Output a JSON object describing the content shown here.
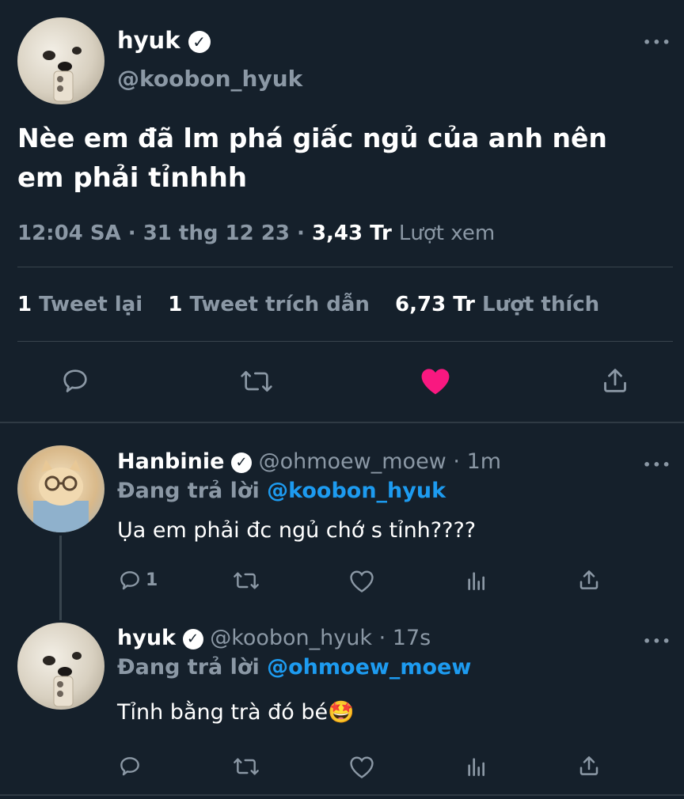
{
  "main_tweet": {
    "display_name": "hyuk",
    "handle": "@koobon_hyuk",
    "text_line1": "Nèe em đã lm phá giấc ngủ của anh nên",
    "text_line2": "em phải tỉnhhh",
    "time": "12:04 SA",
    "sep": "·",
    "date": "31 thg 12 23",
    "views_count": "3,43 Tr",
    "views_label": "Lượt xem",
    "retweets_count": "1",
    "retweets_label": "Tweet lại",
    "quotes_count": "1",
    "quotes_label": "Tweet trích dẫn",
    "likes_count": "6,73 Tr",
    "likes_label": "Lượt thích",
    "liked": true,
    "like_color": "#f91880"
  },
  "reply1": {
    "display_name": "Hanbinie",
    "handle": "@ohmoew_moew",
    "sep": "·",
    "age": "1m",
    "replying_label": "Đang trả lời",
    "replying_to": "@koobon_hyuk",
    "text": "Ụa em phải đc ngủ chớ s tỉnh????",
    "reply_count": "1"
  },
  "reply2": {
    "display_name": "hyuk",
    "handle": "@koobon_hyuk",
    "sep": "·",
    "age": "17s",
    "replying_label": "Đang trả lời",
    "replying_to": "@ohmoew_moew",
    "text": "Tỉnh bằng trà đó bé🤩"
  },
  "icons": {
    "verified": "✓",
    "more": "•••",
    "names": [
      "reply-icon",
      "retweet-icon",
      "like-icon",
      "share-icon",
      "analytics-icon"
    ]
  },
  "colors": {
    "background": "#15202b",
    "secondary_text": "#8b98a5",
    "link": "#1d9bf0",
    "divider": "#38444d"
  }
}
